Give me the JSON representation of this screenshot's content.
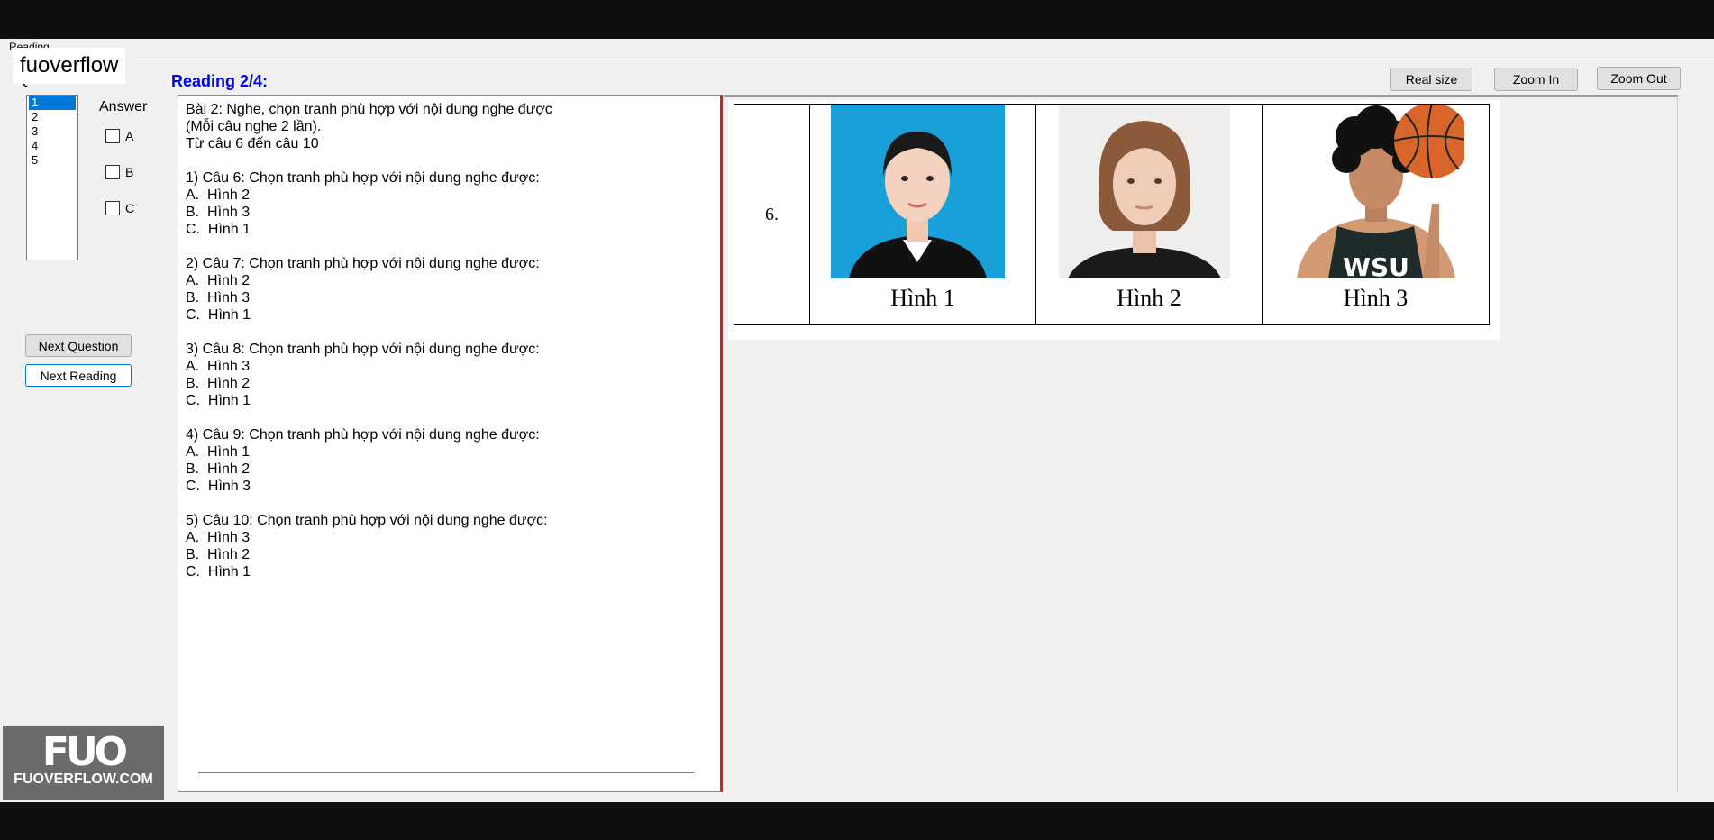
{
  "window": {
    "tab_label": "Reading"
  },
  "watermark": {
    "top_text": "fuoverflow",
    "logo_mark": "FUO",
    "logo_text": "FUOVERFLOW.COM"
  },
  "questions": {
    "label": "Questions",
    "items": [
      "1",
      "2",
      "3",
      "4",
      "5"
    ],
    "selected": "1"
  },
  "reading": {
    "title": "Reading 2/4:"
  },
  "answer": {
    "label": "Answer",
    "options": [
      "A",
      "B",
      "C"
    ]
  },
  "buttons": {
    "next_question": "Next Question",
    "next_reading": "Next Reading",
    "real_size": "Real size",
    "zoom_in": "Zoom In",
    "zoom_out": "Zoom Out"
  },
  "text": {
    "body": "Bài 2: Nghe, chọn tranh phù hợp với nội dung nghe được\n(Mỗi câu nghe 2 lần).\nTừ câu 6 đến câu 10\n\n1) Câu 6: Chọn tranh phù hợp với nội dung nghe được:\nA.  Hình 2\nB.  Hình 3\nC.  Hình 1\n\n2) Câu 7: Chọn tranh phù hợp với nội dung nghe được:\nA.  Hình 2\nB.  Hình 3\nC.  Hình 1\n\n3) Câu 8: Chọn tranh phù hợp với nội dung nghe được:\nA.  Hình 3\nB.  Hình 2\nC.  Hình 1\n\n4) Câu 9: Chọn tranh phù hợp với nội dung nghe được:\nA.  Hình 1\nB.  Hình 2\nC.  Hình 3\n\n5) Câu 10: Chọn tranh phù hợp với nội dung nghe được:\nA.  Hình 3\nB.  Hình 2\nC.  Hình 1"
  },
  "figure": {
    "number": "6.",
    "captions": [
      "Hình 1",
      "Hình 2",
      "Hình 3"
    ],
    "colors": {
      "photo1_bg": "#1aa0d8",
      "photo2_bg": "#efeeec",
      "jersey": "#1f2b2b",
      "ball": "#d8662a"
    }
  }
}
